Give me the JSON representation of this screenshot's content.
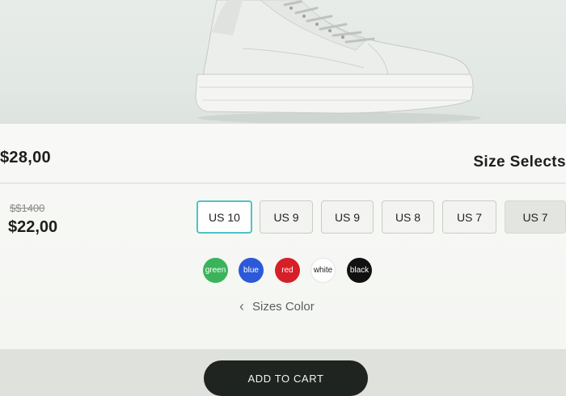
{
  "product": {
    "title": "Size Selects",
    "price": "$28,00",
    "old_price": "$$1400",
    "sale_price": "$22,00"
  },
  "sizes": [
    {
      "label": "US 7",
      "state": "dim"
    },
    {
      "label": "US 7",
      "state": "normal"
    },
    {
      "label": "US 8",
      "state": "normal"
    },
    {
      "label": "US 9",
      "state": "normal"
    },
    {
      "label": "US 9",
      "state": "normal"
    },
    {
      "label": "US 10",
      "state": "selected"
    }
  ],
  "colors": [
    {
      "label": "black",
      "hex": "#111111"
    },
    {
      "label": "white",
      "hex": "#ffffff"
    },
    {
      "label": "red",
      "hex": "#d61f26"
    },
    {
      "label": "blue",
      "hex": "#2b59d9"
    },
    {
      "label": "green",
      "hex": "#3bb35a"
    }
  ],
  "sizes_color_label": "Sizes Color",
  "cart_button_label": "ADD TO CART"
}
